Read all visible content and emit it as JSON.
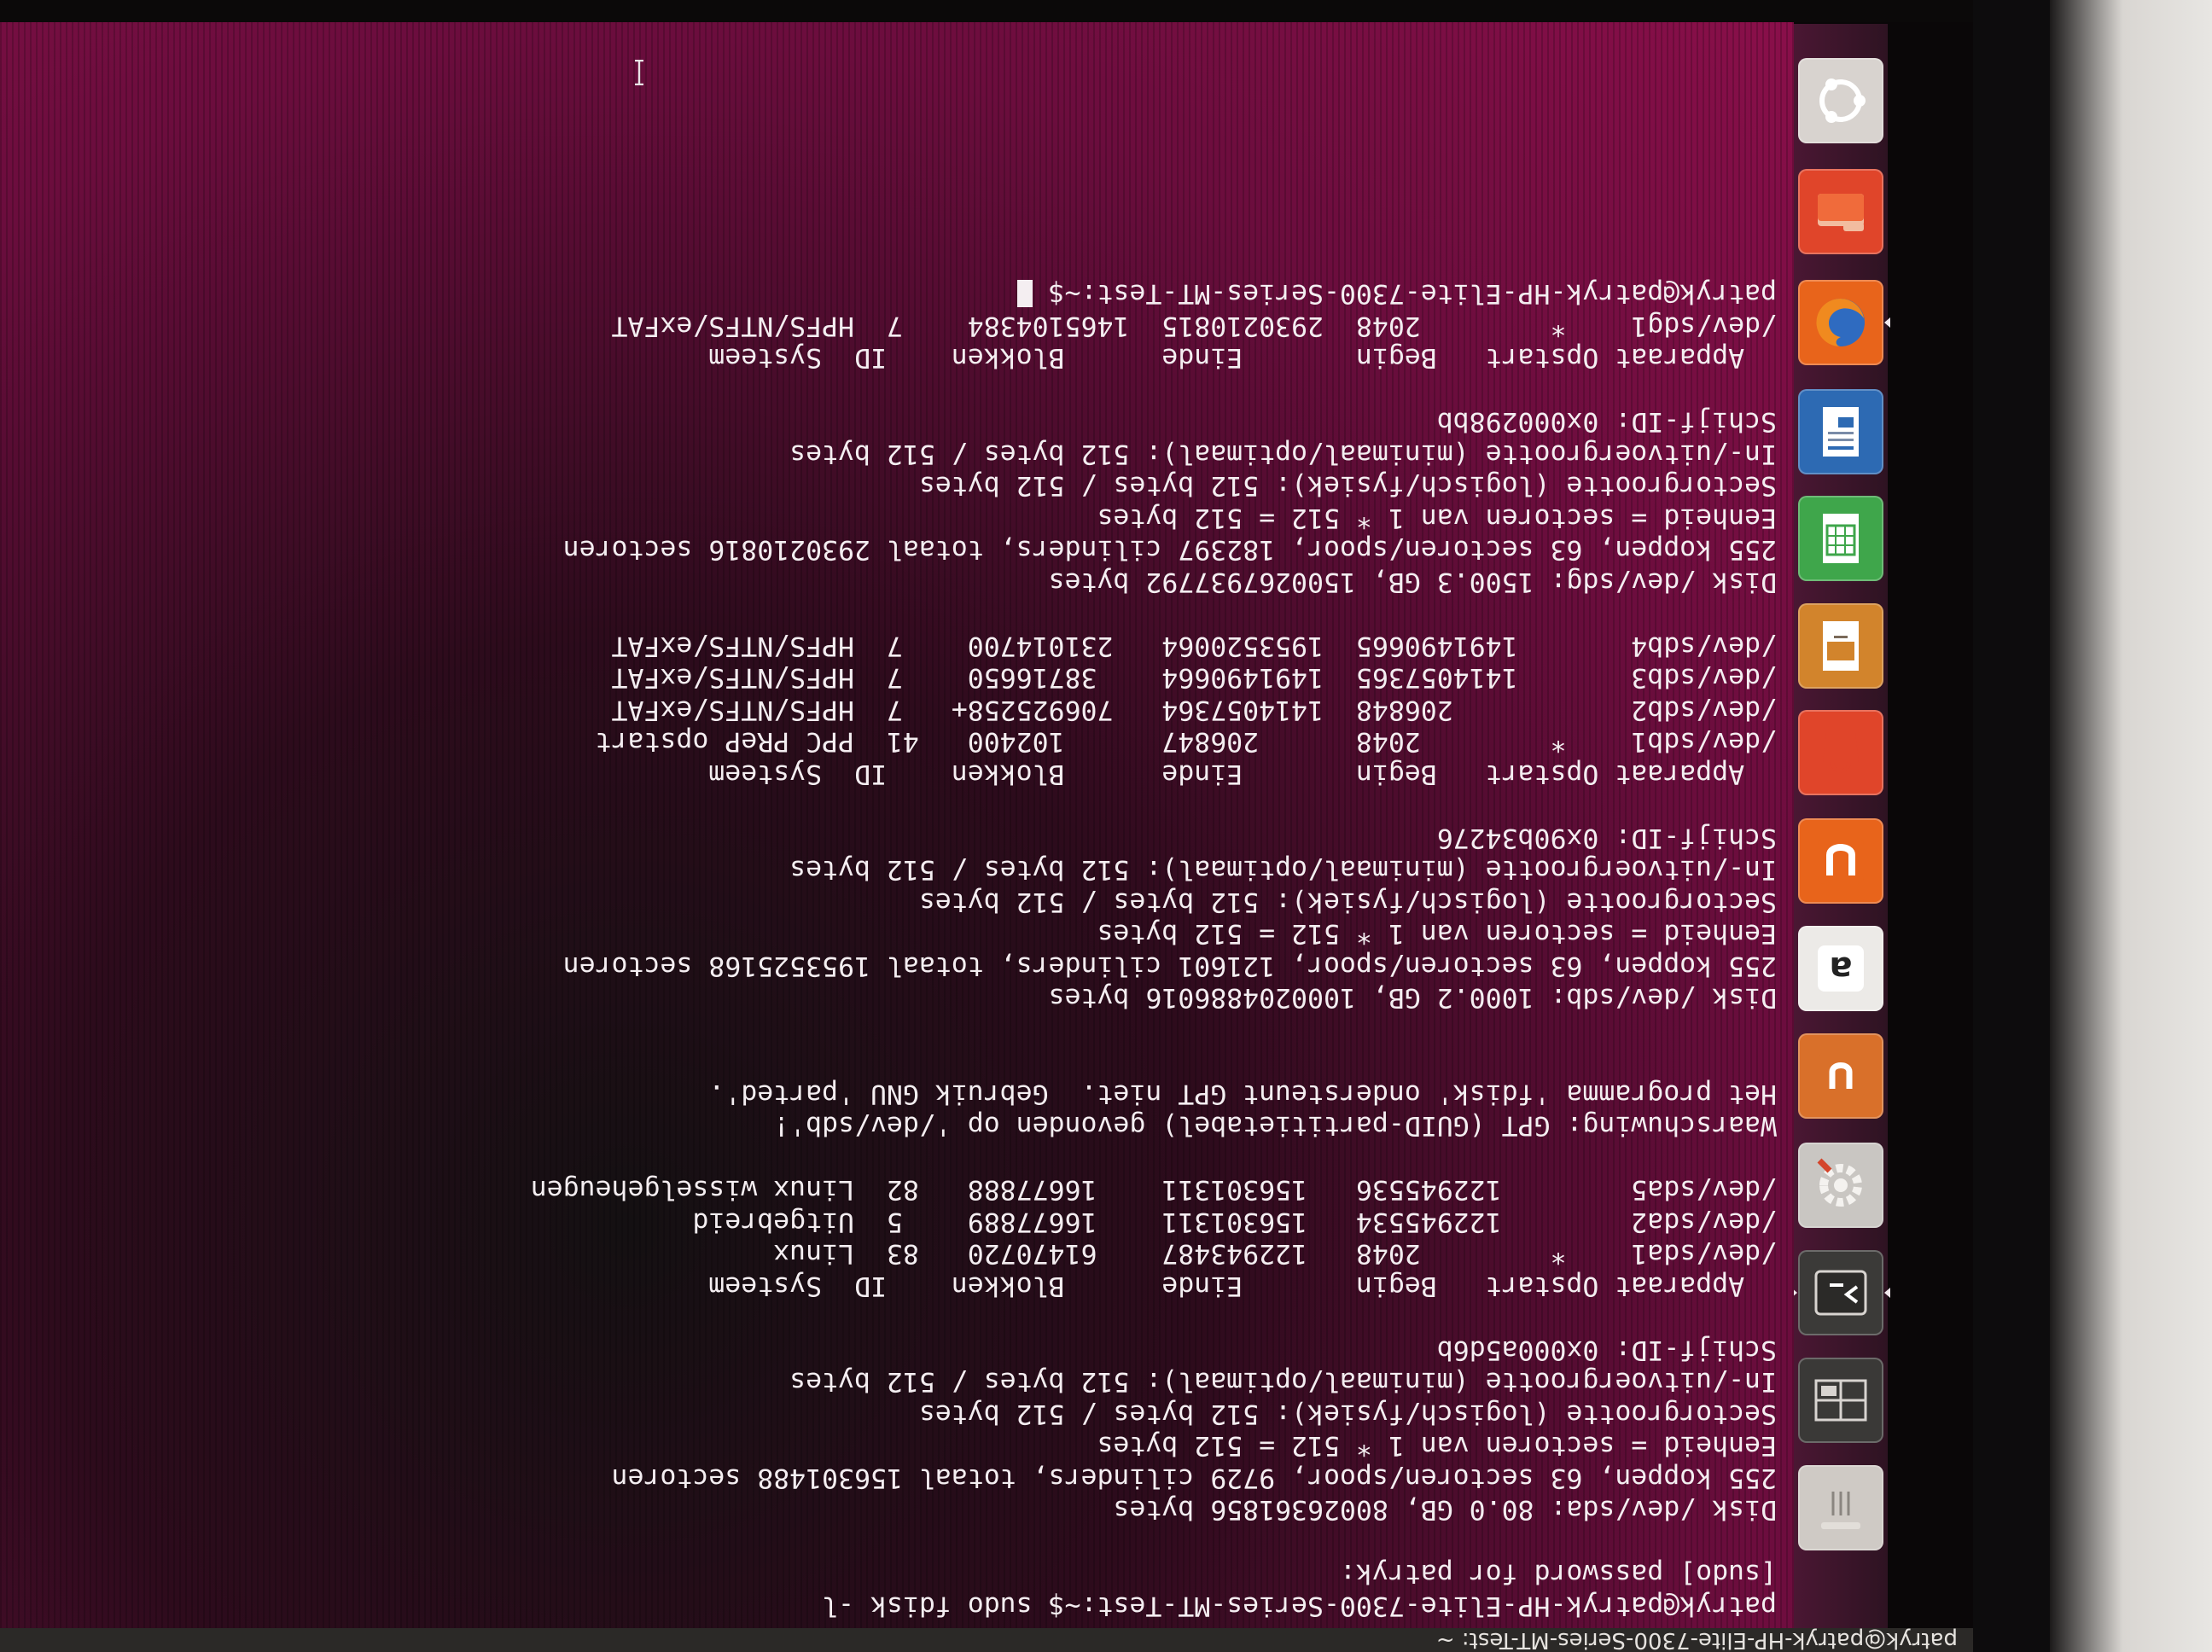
{
  "top_panel": {
    "title": "patryk@patryk-HP-Elite-7300-Series-MT-Test: ~"
  },
  "launcher": {
    "items": [
      {
        "name": "dash-home",
        "icon": "ubuntu-logo-icon",
        "color": "#d8d3cf"
      },
      {
        "name": "files",
        "icon": "folder-icon",
        "color": "#e0452a"
      },
      {
        "name": "firefox",
        "icon": "firefox-icon",
        "color": "#e8641b"
      },
      {
        "name": "libreoffice-writer",
        "icon": "writer-document-icon",
        "color": "#2d6ab3"
      },
      {
        "name": "libreoffice-calc",
        "icon": "calc-spreadsheet-icon",
        "color": "#3fa64b"
      },
      {
        "name": "libreoffice-impress",
        "icon": "impress-presentation-icon",
        "color": "#d2842c"
      },
      {
        "name": "software-center",
        "icon": "shopping-bag-icon",
        "color": "#e0452a"
      },
      {
        "name": "ubuntu-one",
        "icon": "ubuntu-one-icon",
        "color": "#e8641b"
      },
      {
        "name": "amazon",
        "icon": "amazon-icon",
        "color": "#eceae7"
      },
      {
        "name": "ubuntu-one-music",
        "icon": "ubuntu-one-music-icon",
        "color": "#d9702a"
      },
      {
        "name": "system-settings",
        "icon": "gear-wrench-icon",
        "color": "#c9c6c2"
      },
      {
        "name": "terminal",
        "icon": "terminal-icon",
        "color": "#3b3a38"
      },
      {
        "name": "workspace-switcher",
        "icon": "workspace-switcher-icon",
        "color": "#3a3937"
      },
      {
        "name": "trash",
        "icon": "trash-icon",
        "color": "#cfcac5"
      }
    ]
  },
  "terminal": {
    "lines": [
      "patryk@patryk-HP-Elite-7300-Series-MT-Test:~$ sudo fdisk -l",
      "[sudo] password for patryk:",
      "",
      "Disk /dev/sda: 80.0 GB, 80026361856 bytes",
      "255 koppen, 63 sectoren/spoor, 9729 cilinders, totaal 156301488 sectoren",
      "Eenheid = sectoren van 1 * 512 = 512 bytes",
      "Sectorgrootte (logisch/fysiek): 512 bytes / 512 bytes",
      "In-/uitvoergrootte (minimaal/optimaal): 512 bytes / 512 bytes",
      "Schijf-ID: 0x000a5d6b",
      "",
      "  Apparaat Opstart   Begin       Einde      Blokken    ID  Systeem",
      "/dev/sda1    *        2048   122943487    61470720   83  Linux",
      "/dev/sda2        122945534   156301311    16677889    5  Uitgebreid",
      "/dev/sda5        122945536   156301311    16677888   82  Linux wisselgeheugen",
      "",
      "Waarschuwing: GPT (GUID-partitietabel) gevonden op '/dev/sdb'!",
      "Het programma 'fdisk' ondersteunt GPT niet.  Gebruik GNU 'parted'.",
      "",
      "",
      "Disk /dev/sdb: 1000.2 GB, 1000204886016 bytes",
      "255 koppen, 63 sectoren/spoor, 121601 cilinders, totaal 1953525168 sectoren",
      "Eenheid = sectoren van 1 * 512 = 512 bytes",
      "Sectorgrootte (logisch/fysiek): 512 bytes / 512 bytes",
      "In-/uitvoergrootte (minimaal/optimaal): 512 bytes / 512 bytes",
      "Schijf-ID: 0x90b34276",
      "",
      "  Apparaat Opstart   Begin       Einde      Blokken    ID  Systeem",
      "/dev/sdb1    *        2048      206847      102400   41  PPC PReP opstart",
      "/dev/sdb2           206848  1414057364   706925258+   7  HPFS/NTFS/exFAT",
      "/dev/sdb3       1414057365  1491490664    38716650    7  HPFS/NTFS/exFAT",
      "/dev/sdb4       1491490665  1953520064   231014700    7  HPFS/NTFS/exFAT",
      "",
      "Disk /dev/sdg: 1500.3 GB, 1500267937792 bytes",
      "255 koppen, 63 sectoren/spoor, 182397 cilinders, totaal 2930210816 sectoren",
      "Eenheid = sectoren van 1 * 512 = 512 bytes",
      "Sectorgrootte (logisch/fysiek): 512 bytes / 512 bytes",
      "In-/uitvoergrootte (minimaal/optimaal): 512 bytes / 512 bytes",
      "Schijf-ID: 0x000298bb",
      "",
      "  Apparaat Opstart   Begin       Einde      Blokken    ID  Systeem",
      "/dev/sdg1    *        2048  2930210815  1465104384    7  HPFS/NTFS/exFAT",
      "patryk@patryk-HP-Elite-7300-Series-MT-Test:~$ "
    ]
  }
}
